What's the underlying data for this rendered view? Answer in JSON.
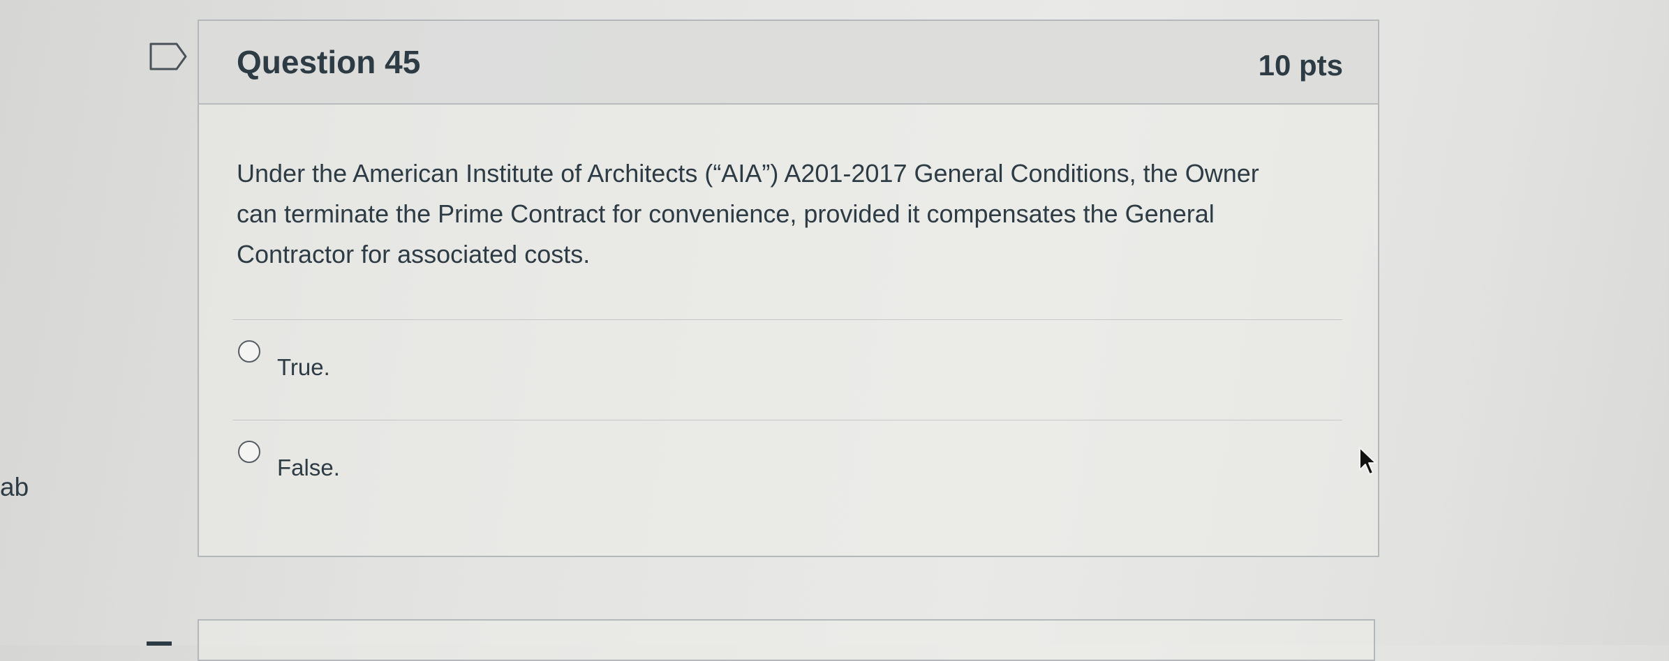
{
  "side": {
    "tab_fragment": "ab"
  },
  "question": {
    "title": "Question 45",
    "points": "10 pts",
    "text": "Under the American Institute of Architects (“AIA”) A201-2017 General Conditions, the Owner can terminate the Prime Contract for convenience, provided it compensates the General Contractor for associated costs.",
    "answers": [
      {
        "label": "True.",
        "selected": false
      },
      {
        "label": "False.",
        "selected": false
      }
    ]
  },
  "icons": {
    "flag": "flag-question-icon",
    "cursor": "mouse-pointer-icon",
    "radio": "radio-button-icon"
  },
  "colors": {
    "text": "#2d3b45",
    "border": "#b5b8bb",
    "header_bg": "#d8d9d8"
  }
}
